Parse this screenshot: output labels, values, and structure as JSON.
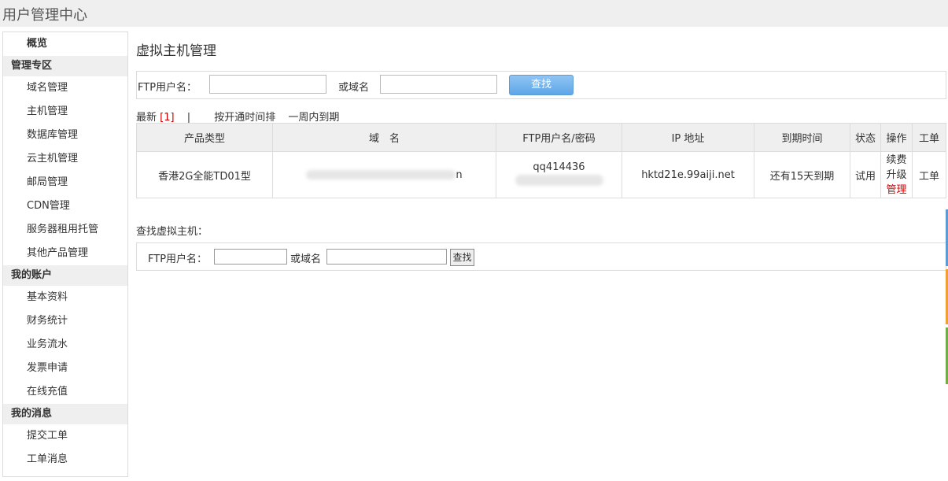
{
  "header": {
    "title": "用户管理中心"
  },
  "sidebar": {
    "overview": "概览",
    "sections": [
      {
        "title": "管理专区",
        "items": [
          "域名管理",
          "主机管理",
          "数据库管理",
          "云主机管理",
          "邮局管理",
          "CDN管理",
          "服务器租用托管",
          "其他产品管理"
        ]
      },
      {
        "title": "我的账户",
        "items": [
          "基本资料",
          "财务统计",
          "业务流水",
          "发票申请",
          "在线充值"
        ]
      },
      {
        "title": "我的消息",
        "items": [
          "提交工单",
          "工单消息"
        ]
      }
    ]
  },
  "main": {
    "title": "虚拟主机管理",
    "search": {
      "ftp_label": "FTP用户名：",
      "domain_label": "或域名",
      "button": "查找",
      "ftp_value": "",
      "domain_value": ""
    },
    "filters": {
      "latest": "最新",
      "count": "[1]",
      "sep": "|",
      "by_open_time": "按开通时间排",
      "expire_week": "一周内到期"
    },
    "table": {
      "headers": [
        "产品类型",
        "域　名",
        "FTP用户名/密码",
        "IP 地址",
        "到期时间",
        "状态",
        "操作",
        "工单"
      ],
      "row": {
        "product": "香港2G全能TD01型",
        "domain_tail": "n",
        "ftp_user": "qq414436",
        "ip": "hktd21e.99aiji.net",
        "expire": "还有15天到期",
        "status": "试用",
        "ops": [
          "续费",
          "升级",
          "管理"
        ],
        "ticket": "工单"
      }
    },
    "search2": {
      "section_label": "查找虚拟主机：",
      "ftp_label": "FTP用户名：",
      "domain_label": "或域名",
      "button": "查找"
    }
  },
  "colors": {
    "accent_blue": "#5b9bd5",
    "accent_orange": "#f0a030",
    "accent_green": "#70ad47",
    "alert_red": "#d00000"
  }
}
